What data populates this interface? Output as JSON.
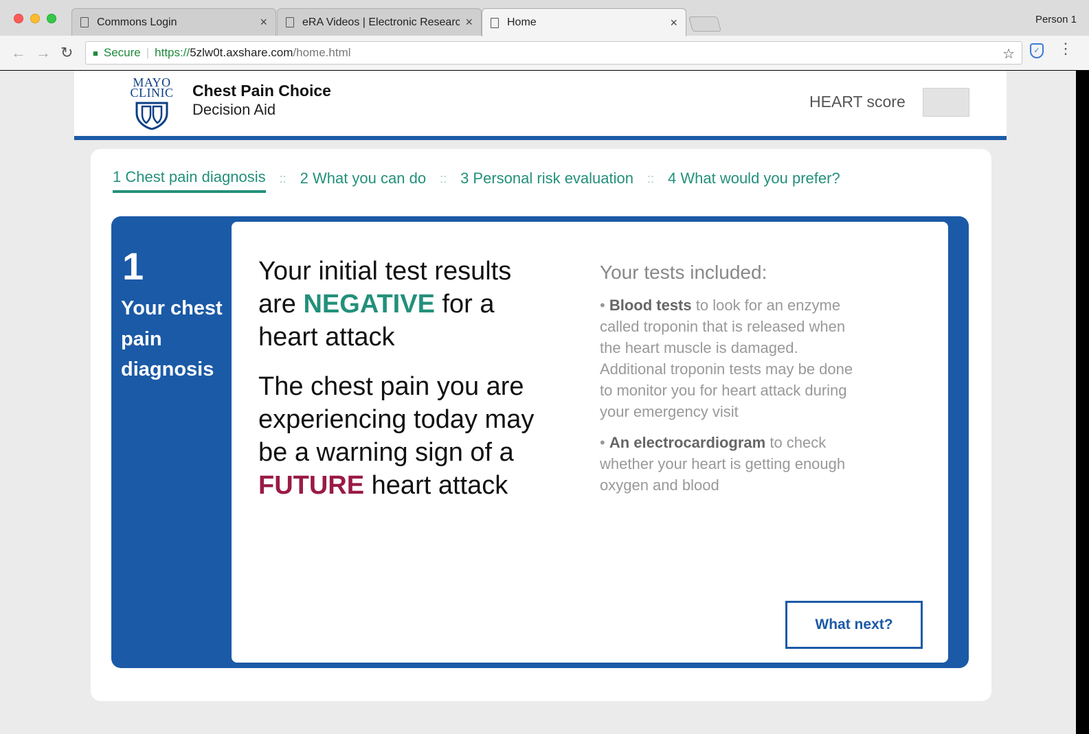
{
  "browser": {
    "tabs": [
      {
        "label": "Commons Login",
        "close": "×"
      },
      {
        "label": "eRA Videos | Electronic Research Administration",
        "close": "×"
      },
      {
        "label": "Home",
        "close": "×"
      }
    ],
    "profile": "Person 1",
    "address": {
      "secure_label": "Secure",
      "scheme": "https://",
      "host": "5zlw0t.axshare.com",
      "path": "/home.html"
    },
    "icons": [
      "back-arrow-icon",
      "forward-arrow-icon",
      "reload-icon",
      "lock-icon",
      "star-icon",
      "shield-extension-icon",
      "menu-dots-icon"
    ]
  },
  "header": {
    "logo_line1": "MAYO",
    "logo_line2": "CLINIC",
    "title": "Chest Pain Choice",
    "subtitle": "Decision Aid",
    "heart_score_label": "HEART score"
  },
  "steps": [
    {
      "label": "1 Chest pain diagnosis",
      "active": true
    },
    {
      "label": "2 What you can do",
      "active": false
    },
    {
      "label": "3 Personal risk evaluation",
      "active": false
    },
    {
      "label": "4 What would you prefer?",
      "active": false
    }
  ],
  "step_separator": "::",
  "panel": {
    "number": "1",
    "title": "Your chest pain diagnosis",
    "lead1": {
      "pre": "Your initial test results are ",
      "emph": "NEGATIVE",
      "post": " for a heart attack"
    },
    "lead2": {
      "pre": "The chest pain you are experiencing today may be a warning sign of a ",
      "emph": "FUTURE",
      "post": " heart attack"
    },
    "tests_title": "Your tests included:",
    "tests": [
      {
        "bold": "Blood tests",
        "text": " to look for an enzyme called troponin that is released when the heart muscle is damaged. Additional troponin tests may be done to monitor you for heart attack during your emergency visit"
      },
      {
        "bold": "An electrocardiogram",
        "text": " to check whether your heart is getting enough oxygen and blood"
      }
    ],
    "next_button": "What next?"
  },
  "colors": {
    "brand_blue": "#1b5aa6",
    "teal": "#23907b",
    "future_red": "#9a1b45"
  }
}
